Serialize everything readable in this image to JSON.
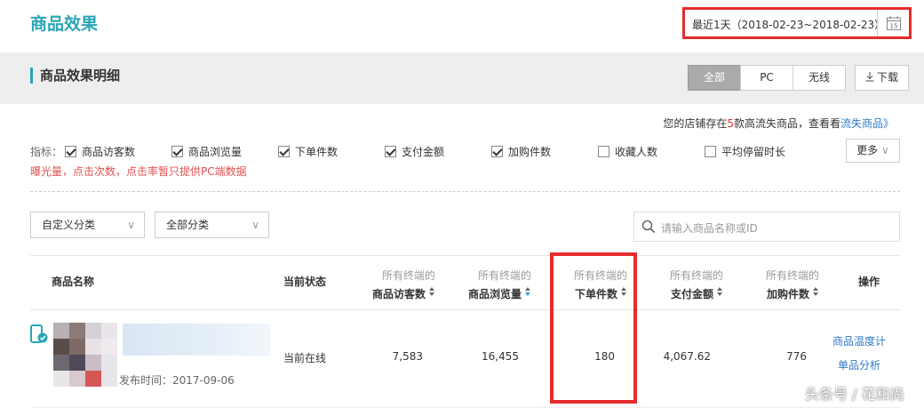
{
  "header": {
    "title": "商品效果",
    "date_range": "最近1天（2018-02-23~2018-02-23）",
    "calendar_day": "15"
  },
  "section": {
    "title": "商品效果明细",
    "tabs": [
      {
        "label": "全部",
        "active": true
      },
      {
        "label": "PC",
        "active": false
      },
      {
        "label": "无线",
        "active": false
      }
    ],
    "download_label": "下载"
  },
  "notice": {
    "prefix": "您的店铺存在",
    "count": "5",
    "middle": "款高流失商品，查看看",
    "link": "流失商品》"
  },
  "metrics": {
    "label": "指标：",
    "items": [
      {
        "label": "商品访客数",
        "checked": true
      },
      {
        "label": "商品浏览量",
        "checked": true
      },
      {
        "label": "下单件数",
        "checked": true
      },
      {
        "label": "支付金额",
        "checked": true
      },
      {
        "label": "加购件数",
        "checked": true
      },
      {
        "label": "收藏人数",
        "checked": false
      },
      {
        "label": "平均停留时长",
        "checked": false
      }
    ],
    "more_label": "更多",
    "warning": "曝光量，点击次数，点击率暂只提供PC端数据"
  },
  "filters": {
    "custom_category": "自定义分类",
    "all_category": "全部分类",
    "search_placeholder": "请输入商品名称或ID"
  },
  "table": {
    "headers": {
      "name": "商品名称",
      "status": "当前状态",
      "prefix": "所有终端的",
      "visitors": "商品访客数",
      "views": "商品浏览量",
      "orders": "下单件数",
      "payment": "支付金额",
      "cart": "加购件数",
      "actions": "操作"
    },
    "rows": [
      {
        "publish_time": "发布时间：2017-09-06",
        "status": "当前在线",
        "visitors": "7,583",
        "views": "16,455",
        "orders": "180",
        "payment": "4,067.62",
        "cart": "776",
        "action1": "商品温度计",
        "action2": "单品分析"
      }
    ]
  },
  "watermark": "头条号 / 花和尚",
  "colors": {
    "accent": "#2aa6b5",
    "highlight": "#e52c2c",
    "link": "#2e79c9"
  }
}
